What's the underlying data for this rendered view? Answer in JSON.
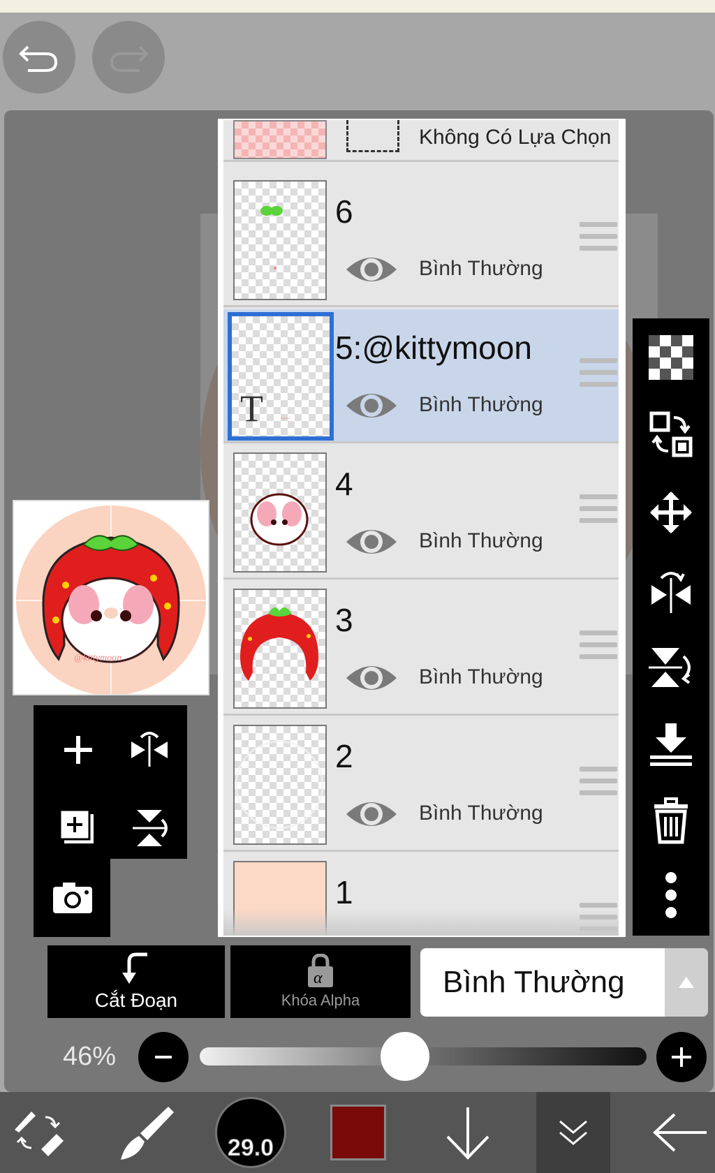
{
  "header": {
    "undo_icon": "undo-icon",
    "redo_icon": "redo-icon"
  },
  "layers_panel": {
    "selection_row": {
      "label": "Không Có Lựa Chọn"
    },
    "layers": [
      {
        "name": "6",
        "mode": "Bình Thường",
        "selected": false
      },
      {
        "name": "5:@kittymoon",
        "mode": "Bình Thường",
        "selected": true,
        "thumb_letter": "T"
      },
      {
        "name": "4",
        "mode": "Bình Thường",
        "selected": false
      },
      {
        "name": "3",
        "mode": "Bình Thường",
        "selected": false
      },
      {
        "name": "2",
        "mode": "Bình Thường",
        "selected": false
      },
      {
        "name": "1",
        "mode": "",
        "selected": false
      }
    ]
  },
  "right_toolbar": [
    "transparency-icon",
    "swap-layers-icon",
    "move-icon",
    "flip-horizontal-icon",
    "flip-vertical-icon",
    "merge-down-icon",
    "trash-icon",
    "more-icon"
  ],
  "left_toolbar": [
    "add-layer-icon",
    "flip-horizontal-icon",
    "add-folder-icon",
    "flip-vertical-icon",
    "camera-icon"
  ],
  "controls": {
    "clip_label": "Cắt Đoạn",
    "alpha_lock_label": "Khóa Alpha",
    "blend_mode": "Bình Thường"
  },
  "opacity": {
    "label": "46%",
    "value": 0.46
  },
  "bottom_bar": {
    "brush_size": "29.0",
    "color": "#7a0a0a"
  },
  "colors": {
    "selected_layer": "#c9d6ea",
    "selected_border": "#2e6fd4",
    "layer1_fill": "#fcd8c6"
  }
}
